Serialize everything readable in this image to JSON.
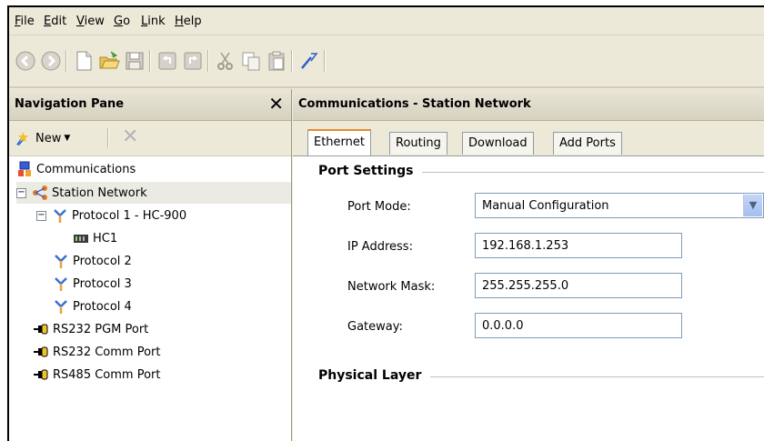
{
  "menu": [
    {
      "key": "F",
      "rest": "ile"
    },
    {
      "key": "E",
      "rest": "dit"
    },
    {
      "key": "V",
      "rest": "iew"
    },
    {
      "key": "G",
      "rest": "o"
    },
    {
      "key": "L",
      "rest": "ink"
    },
    {
      "key": "H",
      "rest": "elp"
    }
  ],
  "toolbar_icons": [
    "back-icon",
    "forward-icon",
    "new-document-icon",
    "open-folder-icon",
    "save-icon",
    "undo-icon",
    "redo-icon",
    "cut-icon",
    "copy-icon",
    "paste-icon",
    "wand-icon"
  ],
  "nav": {
    "title": "Navigation Pane",
    "close": "✕",
    "new_label": "New",
    "tree": [
      {
        "label": "Communications"
      },
      {
        "label": "Station Network",
        "expander": "−"
      },
      {
        "label": "Protocol 1 - HC-900",
        "expander": "−"
      },
      {
        "label": "HC1"
      },
      {
        "label": "Protocol 2"
      },
      {
        "label": "Protocol 3"
      },
      {
        "label": "Protocol 4"
      },
      {
        "label": "RS232 PGM Port"
      },
      {
        "label": "RS232 Comm Port"
      },
      {
        "label": "RS485 Comm Port"
      }
    ]
  },
  "main": {
    "title": "Communications - Station Network",
    "tabs": [
      "Ethernet",
      "Routing",
      "Download",
      "Add Ports"
    ],
    "port_settings": {
      "section": "Port Settings",
      "port_mode_label": "Port Mode:",
      "port_mode_value": "Manual Configuration",
      "ip_label": "IP Address:",
      "ip_value": "192.168.1.253",
      "mask_label": "Network Mask:",
      "mask_value": "255.255.255.0",
      "gateway_label": "Gateway:",
      "gateway_value": "0.0.0.0"
    },
    "physical_layer": {
      "section": "Physical Layer"
    }
  }
}
